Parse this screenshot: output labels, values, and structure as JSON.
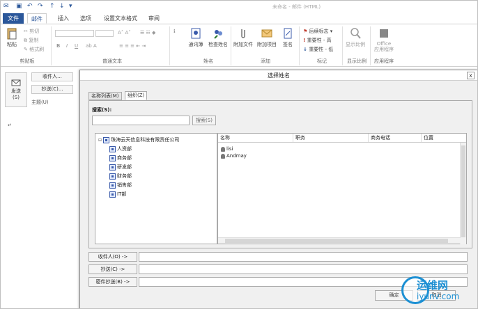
{
  "window": {
    "title": "未命名 - 邮件 (HTML)"
  },
  "tabs": [
    "文件",
    "邮件",
    "插入",
    "选项",
    "设置文本格式",
    "审阅"
  ],
  "ribbon": {
    "clipboard": {
      "paste": "粘贴",
      "cut": "剪切",
      "copy": "复制",
      "format_painter": "格式刷",
      "label": "剪贴板"
    },
    "basic_text": {
      "label": "普通文本"
    },
    "names": {
      "address_book": "通讯簿",
      "check_names": "检查姓名",
      "label": "姓名"
    },
    "include": {
      "attach_file": "附加文件",
      "attach_item": "附加项目",
      "signature": "签名",
      "label": "添加"
    },
    "tags": {
      "follow_up": "后续标志",
      "high_importance": "重要性 - 高",
      "low_importance": "重要性 - 低",
      "label": "标记"
    },
    "zoom": {
      "zoom": "显示比例",
      "label": "显示比例"
    },
    "apps": {
      "office": "Office\n应用程序",
      "label": "应用程序"
    }
  },
  "compose": {
    "send": "发送\n(S)",
    "to": "收件人...",
    "cc": "抄送(C)...",
    "subject": "主题(U)"
  },
  "dialog": {
    "title": "选择姓名",
    "close": "x",
    "tabs": [
      "名称列表(M)",
      "组织(Z)"
    ],
    "search_label": "搜索(S):",
    "search_button": "搜索(S)",
    "tree": {
      "root": "珠海云天信息科技有限责任公司",
      "children": [
        "人资部",
        "商务部",
        "研发部",
        "财务部",
        "销售部",
        "IT部"
      ]
    },
    "list": {
      "columns": [
        "名称",
        "职务",
        "商务电话",
        "位置"
      ],
      "rows": [
        "lisi",
        "Andmay"
      ]
    },
    "recipients": {
      "to": "收件人(O) ->",
      "cc": "抄送(C) ->",
      "bcc": "密件抄送(B) ->"
    },
    "ok": "确定",
    "cancel": "取消"
  },
  "watermark": {
    "brand": "运维网",
    "site": "iyunv.com"
  }
}
